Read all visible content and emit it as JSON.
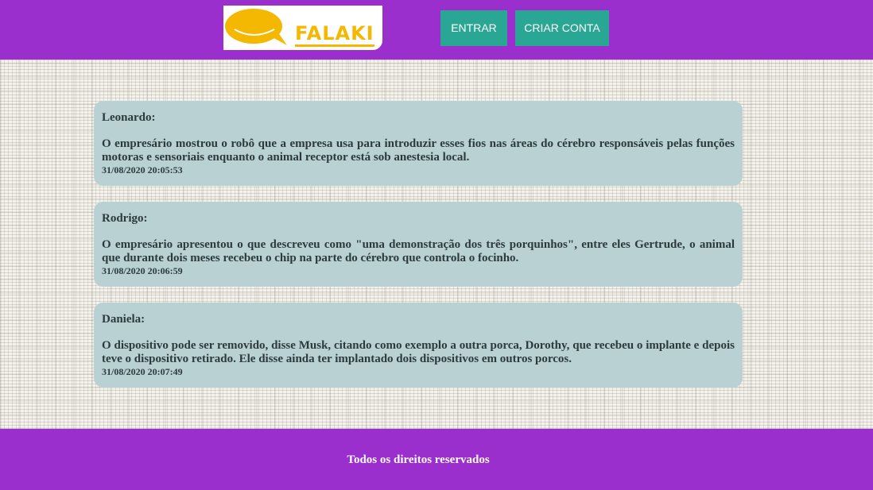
{
  "colors": {
    "brand_purple": "#9b2fce",
    "button_teal": "#2aa694",
    "card_background": "#b9d1d3",
    "logo_yellow": "#f5b800"
  },
  "header": {
    "logo_text": "FALAKI",
    "logo_icon": "speech-bubble-icon",
    "login_label": "ENTRAR",
    "signup_label": "CRIAR CONTA"
  },
  "posts": [
    {
      "author": "Leonardo:",
      "message": "O empresário mostrou o robô que a empresa usa para introduzir esses fios nas áreas do cérebro responsáveis pelas funções motoras e sensoriais enquanto o animal receptor está sob anestesia local.",
      "timestamp": "31/08/2020 20:05:53"
    },
    {
      "author": "Rodrigo:",
      "message": "O empresário apresentou o que descreveu como \"uma demonstração dos três porquinhos\", entre eles Gertrude, o animal que durante dois meses recebeu o chip na parte do cérebro que controla o focinho.",
      "timestamp": "31/08/2020 20:06:59"
    },
    {
      "author": "Daniela:",
      "message": "O dispositivo pode ser removido, disse Musk, citando como exemplo a outra porca, Dorothy, que recebeu o implante e depois teve o dispositivo retirado. Ele disse ainda ter implantado dois dispositivos em outros porcos.",
      "timestamp": "31/08/2020 20:07:49"
    }
  ],
  "footer": {
    "text": "Todos os direitos reservados"
  }
}
